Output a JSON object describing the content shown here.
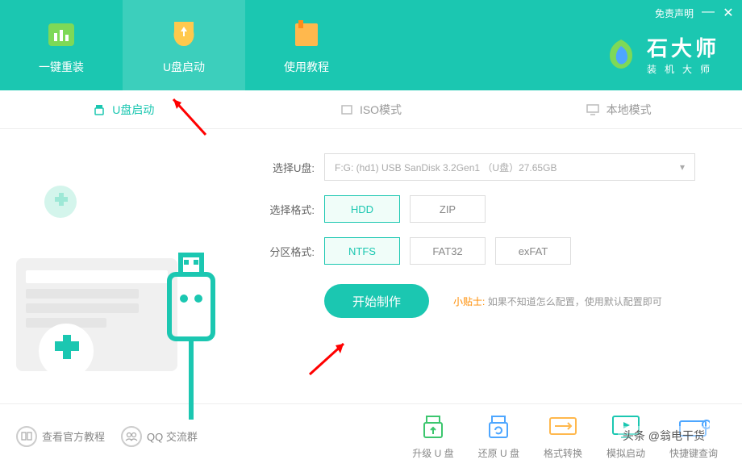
{
  "header": {
    "disclaimer": "免责声明",
    "nav": [
      {
        "label": "一键重装"
      },
      {
        "label": "U盘启动"
      },
      {
        "label": "使用教程"
      }
    ],
    "logo_title": "石大师",
    "logo_subtitle": "装机大师"
  },
  "tabs": {
    "usb": "U盘启动",
    "iso": "ISO模式",
    "local": "本地模式"
  },
  "form": {
    "select_usb_label": "选择U盘:",
    "select_usb_value": "F:G: (hd1)  USB SanDisk 3.2Gen1 （U盘）27.65GB",
    "select_format_label": "选择格式:",
    "format_options": {
      "hdd": "HDD",
      "zip": "ZIP"
    },
    "partition_label": "分区格式:",
    "partition_options": {
      "ntfs": "NTFS",
      "fat32": "FAT32",
      "exfat": "exFAT"
    },
    "start_button": "开始制作",
    "tip_label": "小贴士:",
    "tip_text": "如果不知道怎么配置，使用默认配置即可"
  },
  "footer": {
    "tutorial": "查看官方教程",
    "qq": "QQ 交流群",
    "actions": {
      "upgrade": "升级 U 盘",
      "restore": "还原 U 盘",
      "convert": "格式转换",
      "simulate": "模拟启动",
      "shortcut": "快捷键查询"
    }
  },
  "watermark": "头条 @翁电干货"
}
